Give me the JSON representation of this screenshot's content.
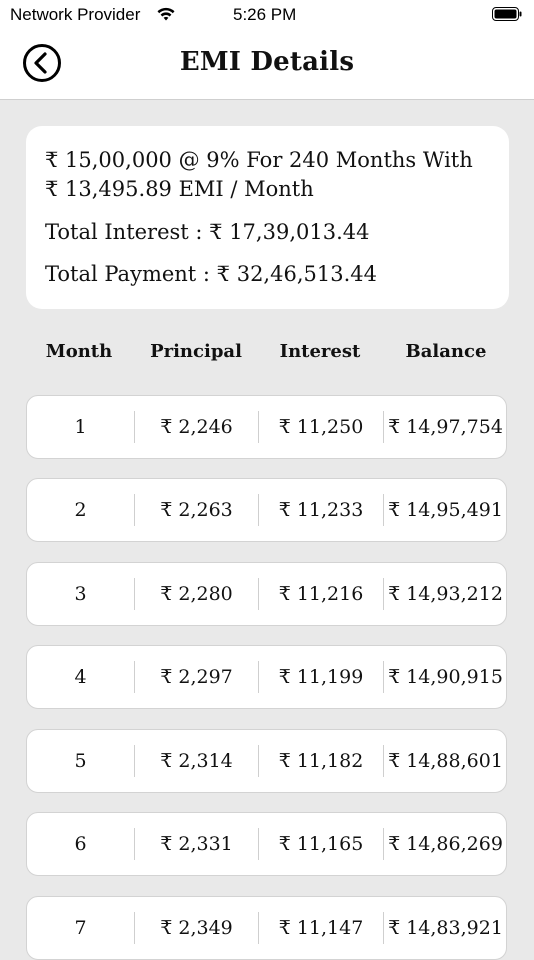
{
  "status_bar": {
    "carrier": "Network Provider",
    "time": "5:26 PM"
  },
  "header": {
    "title": "EMI Details"
  },
  "summary": {
    "line1": "₹  15,00,000 @ 9% For 240 Months With",
    "line2": "₹  13,495.89 EMI / Month",
    "total_interest": "Total Interest : ₹  17,39,013.44",
    "total_payment": "Total Payment : ₹  32,46,513.44"
  },
  "table": {
    "columns": [
      "Month",
      "Principal",
      "Interest",
      "Balance"
    ],
    "rows": [
      {
        "month": "1",
        "principal": "₹  2,246",
        "interest": "₹  11,250",
        "balance": "₹  14,97,754"
      },
      {
        "month": "2",
        "principal": "₹  2,263",
        "interest": "₹  11,233",
        "balance": "₹  14,95,491"
      },
      {
        "month": "3",
        "principal": "₹  2,280",
        "interest": "₹  11,216",
        "balance": "₹  14,93,212"
      },
      {
        "month": "4",
        "principal": "₹  2,297",
        "interest": "₹  11,199",
        "balance": "₹  14,90,915"
      },
      {
        "month": "5",
        "principal": "₹  2,314",
        "interest": "₹  11,182",
        "balance": "₹  14,88,601"
      },
      {
        "month": "6",
        "principal": "₹  2,331",
        "interest": "₹  11,165",
        "balance": "₹  14,86,269"
      },
      {
        "month": "7",
        "principal": "₹  2,349",
        "interest": "₹  11,147",
        "balance": "₹  14,83,921"
      }
    ]
  },
  "icons": {
    "back": "back-arrow-circle-icon",
    "wifi": "wifi-icon",
    "battery": "battery-icon"
  },
  "colors": {
    "background": "#e9e9e9",
    "card": "#ffffff",
    "text": "#111111"
  }
}
